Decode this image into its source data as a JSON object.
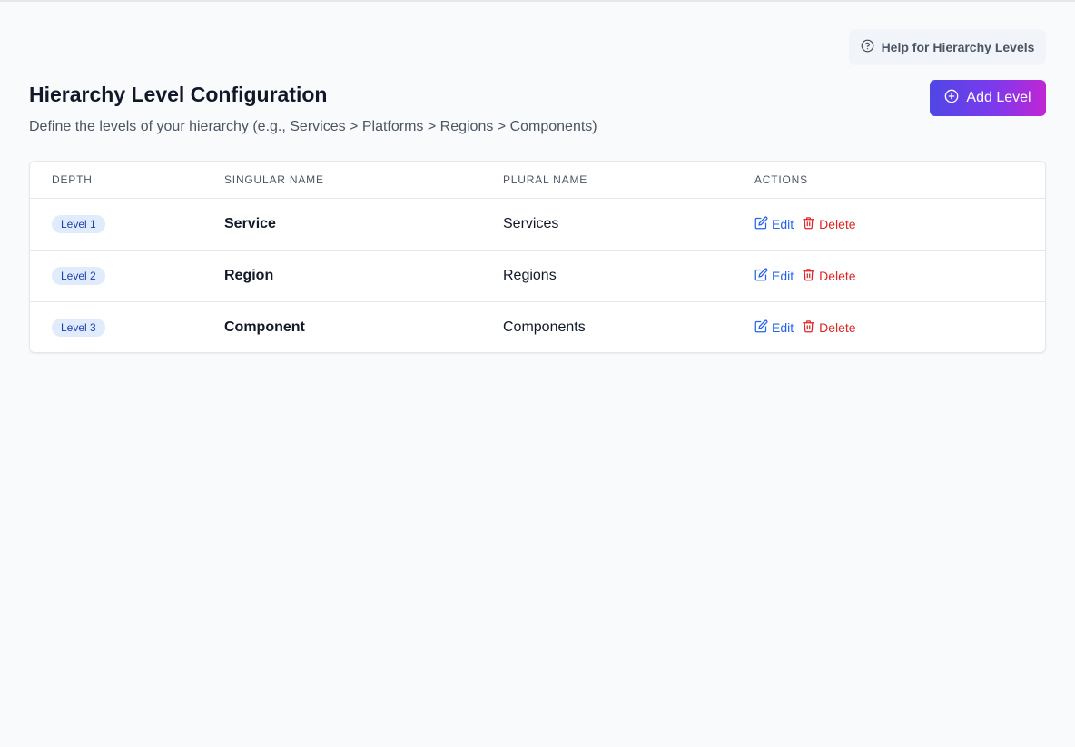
{
  "header": {
    "help_label": "Help for Hierarchy Levels",
    "title": "Hierarchy Level Configuration",
    "subtitle": "Define the levels of your hierarchy (e.g., Services > Platforms > Regions > Components)",
    "add_label": "Add Level"
  },
  "table": {
    "columns": [
      "DEPTH",
      "SINGULAR NAME",
      "PLURAL NAME",
      "ACTIONS"
    ],
    "rows": [
      {
        "depth": "Level 1",
        "singular": "Service",
        "plural": "Services",
        "edit": "Edit",
        "delete": "Delete"
      },
      {
        "depth": "Level 2",
        "singular": "Region",
        "plural": "Regions",
        "edit": "Edit",
        "delete": "Delete"
      },
      {
        "depth": "Level 3",
        "singular": "Component",
        "plural": "Components",
        "edit": "Edit",
        "delete": "Delete"
      }
    ]
  },
  "colors": {
    "accent_start": "#4f46e5",
    "accent_end": "#c026d3",
    "edit": "#2563eb",
    "delete": "#dc2626",
    "badge_bg": "#e0ecfb"
  },
  "icons": {
    "help": "question-circle-icon",
    "add": "plus-circle-icon",
    "edit": "pencil-square-icon",
    "delete": "trash-icon"
  }
}
